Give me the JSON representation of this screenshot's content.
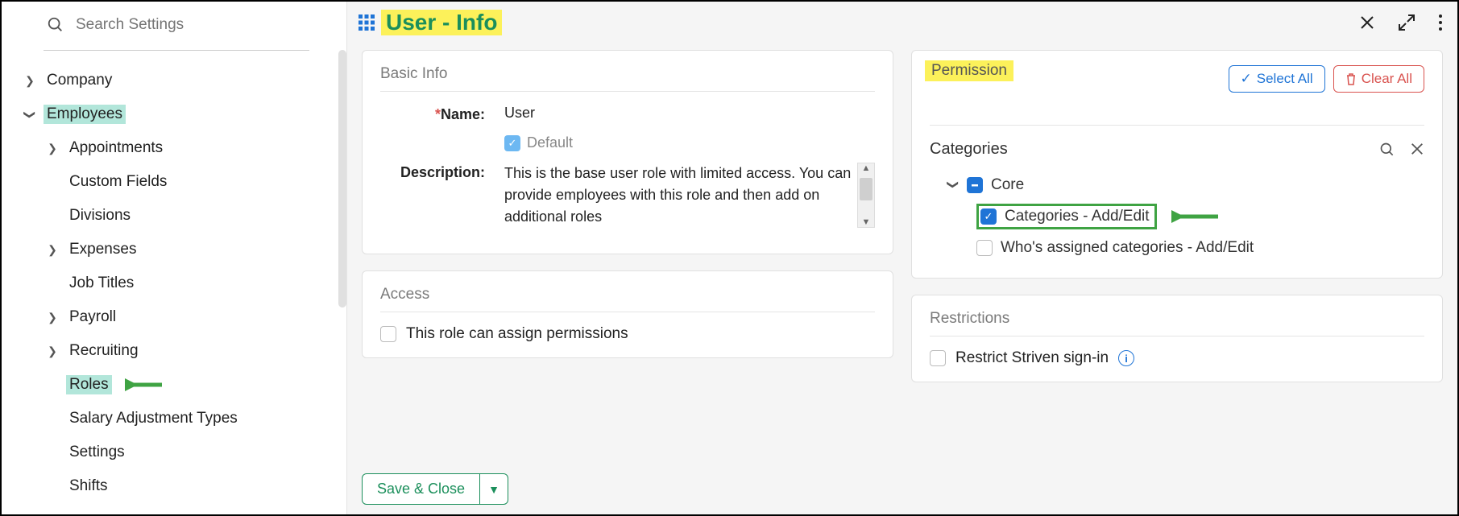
{
  "search": {
    "placeholder": "Search Settings"
  },
  "sidebar": {
    "company": "Company",
    "employees": "Employees",
    "children": {
      "appointments": "Appointments",
      "custom_fields": "Custom Fields",
      "divisions": "Divisions",
      "expenses": "Expenses",
      "job_titles": "Job Titles",
      "payroll": "Payroll",
      "recruiting": "Recruiting",
      "roles": "Roles",
      "salary_adj": "Salary Adjustment Types",
      "settings": "Settings",
      "shifts": "Shifts"
    }
  },
  "header": {
    "title": "User - Info"
  },
  "basic": {
    "card_title": "Basic Info",
    "name_label": "Name:",
    "name_value": "User",
    "default_label": "Default",
    "desc_label": "Description:",
    "desc_value": "This is the base user role with limited access.  You can provide employees with this role and then add on additional roles"
  },
  "access": {
    "card_title": "Access",
    "assign_perm": "This role can assign permissions"
  },
  "permission": {
    "card_title": "Permission",
    "select_all": "Select All",
    "clear_all": "Clear All",
    "categories_label": "Categories",
    "core": "Core",
    "cat_addedit": "Categories - Add/Edit",
    "who_assigned": "Who's assigned categories - Add/Edit"
  },
  "restrictions": {
    "card_title": "Restrictions",
    "restrict_signin": "Restrict Striven sign-in"
  },
  "footer": {
    "save_close": "Save & Close"
  }
}
